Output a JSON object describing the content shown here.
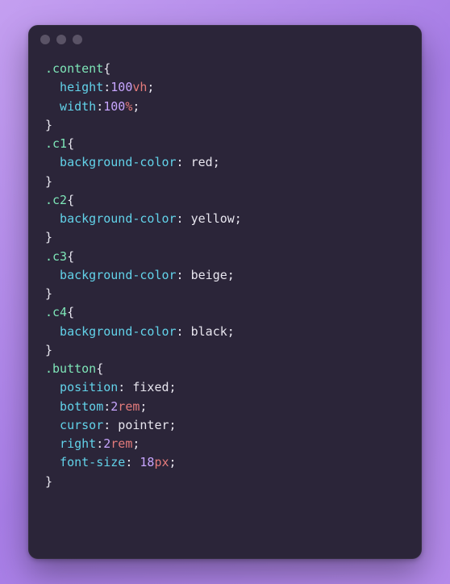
{
  "rules": [
    {
      "selector": ".content",
      "declarations": [
        {
          "property": "height",
          "value": "100",
          "unit": "vh",
          "space_after_colon": false,
          "value_type": "number"
        },
        {
          "property": "width",
          "value": "100",
          "unit": "%",
          "space_after_colon": false,
          "value_type": "number"
        }
      ]
    },
    {
      "selector": ".c1",
      "declarations": [
        {
          "property": "background-color",
          "value": "red",
          "unit": "",
          "space_after_colon": true,
          "value_type": "keyword"
        }
      ]
    },
    {
      "selector": ".c2",
      "declarations": [
        {
          "property": "background-color",
          "value": "yellow",
          "unit": "",
          "space_after_colon": true,
          "value_type": "keyword"
        }
      ]
    },
    {
      "selector": ".c3",
      "declarations": [
        {
          "property": "background-color",
          "value": "beige",
          "unit": "",
          "space_after_colon": true,
          "value_type": "keyword"
        }
      ]
    },
    {
      "selector": ".c4",
      "declarations": [
        {
          "property": "background-color",
          "value": "black",
          "unit": "",
          "space_after_colon": true,
          "value_type": "keyword"
        }
      ]
    },
    {
      "selector": ".button",
      "declarations": [
        {
          "property": "position",
          "value": "fixed",
          "unit": "",
          "space_after_colon": true,
          "value_type": "keyword"
        },
        {
          "property": "bottom",
          "value": "2",
          "unit": "rem",
          "space_after_colon": false,
          "value_type": "number"
        },
        {
          "property": "cursor",
          "value": "pointer",
          "unit": "",
          "space_after_colon": true,
          "value_type": "keyword"
        },
        {
          "property": "right",
          "value": "2",
          "unit": "rem",
          "space_after_colon": false,
          "value_type": "number"
        },
        {
          "property": "font-size",
          "value": "18",
          "unit": "px",
          "space_after_colon": true,
          "value_type": "number"
        }
      ]
    }
  ]
}
